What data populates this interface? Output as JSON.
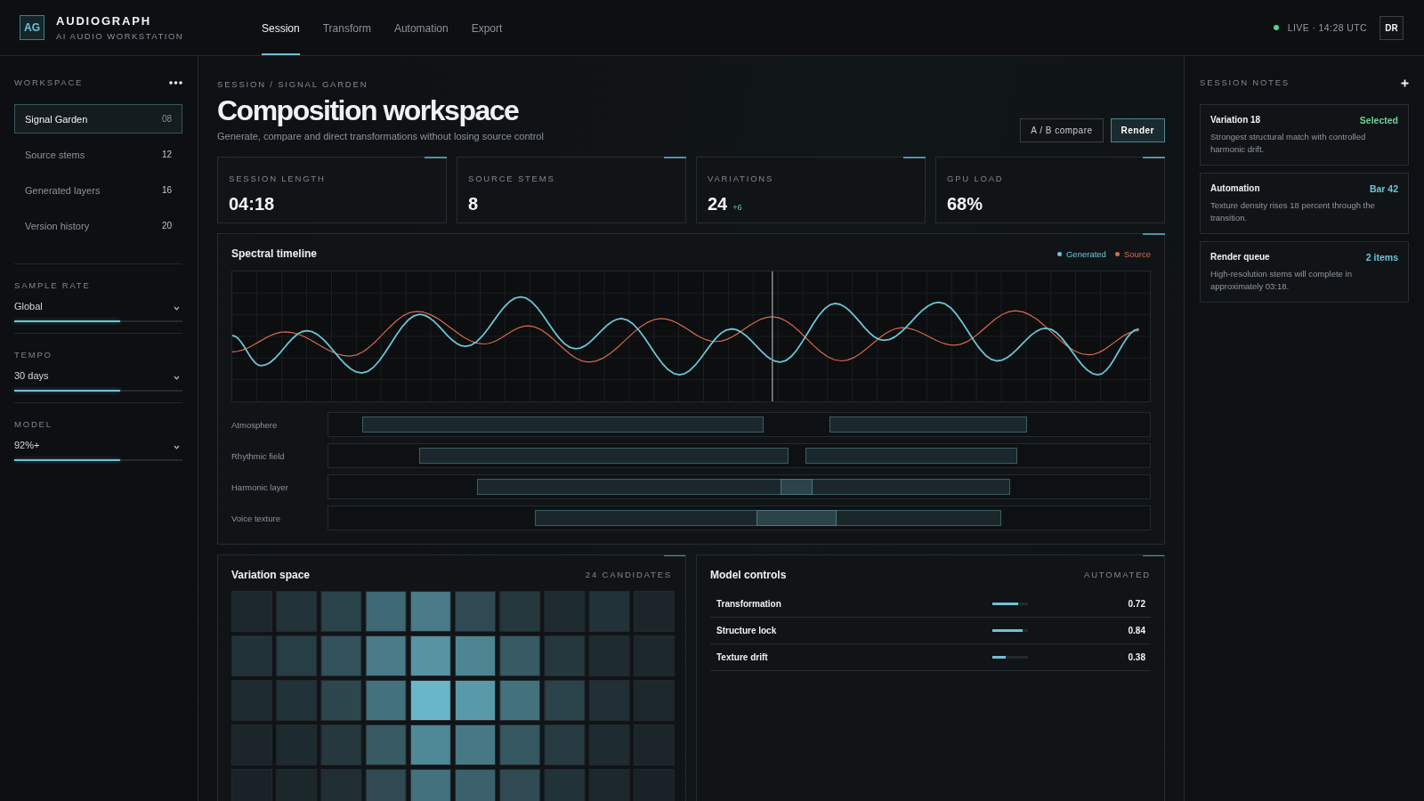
{
  "app": {
    "logo": "AG",
    "name": "AUDIOGRAPH",
    "tagline": "AI AUDIO WORKSTATION"
  },
  "nav": [
    {
      "label": "Session",
      "selected": true
    },
    {
      "label": "Transform",
      "selected": false
    },
    {
      "label": "Automation",
      "selected": false
    },
    {
      "label": "Export",
      "selected": false
    }
  ],
  "status": {
    "live": true,
    "text": "LIVE · 14:28 UTC"
  },
  "user": {
    "initials": "DR"
  },
  "sidebar": {
    "title": "WORKSPACE",
    "items": [
      {
        "label": "Signal Garden",
        "count": "08",
        "selected": true
      },
      {
        "label": "Source stems",
        "count": "12",
        "selected": false
      },
      {
        "label": "Generated layers",
        "count": "16",
        "selected": false
      },
      {
        "label": "Version history",
        "count": "20",
        "selected": false
      }
    ],
    "settings": [
      {
        "label": "SAMPLE RATE",
        "value": "Global",
        "level": 0.63
      },
      {
        "label": "TEMPO",
        "value": "30 days",
        "level": 0.63
      },
      {
        "label": "MODEL",
        "value": "92%+",
        "level": 0.63
      }
    ]
  },
  "page": {
    "breadcrumb": "SESSION / SIGNAL GARDEN",
    "title": "Composition workspace",
    "subtitle": "Generate, compare and direct transformations without losing source control",
    "buttons": [
      {
        "label": "A / B compare",
        "kind": "secondary"
      },
      {
        "label": "Render",
        "kind": "primary"
      }
    ]
  },
  "stats": [
    {
      "label": "SESSION LENGTH",
      "value": "04:18"
    },
    {
      "label": "SOURCE STEMS",
      "value": "8"
    },
    {
      "label": "VARIATIONS",
      "value": "24",
      "delta": "+6"
    },
    {
      "label": "GPU LOAD",
      "value": "68%"
    }
  ],
  "timeline": {
    "title": "Spectral timeline",
    "legend": [
      {
        "label": "Generated",
        "color": "#6cc3d5"
      },
      {
        "label": "Source",
        "color": "#d9694a"
      }
    ],
    "tracks": [
      {
        "name": "Atmosphere"
      },
      {
        "name": "Rhythmic field"
      },
      {
        "name": "Harmonic layer"
      },
      {
        "name": "Voice texture"
      }
    ]
  },
  "variation_space": {
    "title": "Variation space",
    "count": "24 CANDIDATES"
  },
  "model_controls": {
    "title": "Model controls",
    "status": "AUTOMATED",
    "params": [
      {
        "label": "Transformation",
        "level": 0.72,
        "reading": "0.72"
      },
      {
        "label": "Structure lock",
        "level": 0.84,
        "reading": "0.84"
      },
      {
        "label": "Texture drift",
        "level": 0.38,
        "reading": "0.38"
      }
    ]
  },
  "notes": {
    "title": "SESSION NOTES",
    "items": [
      {
        "title": "Variation 18",
        "tag": "Selected",
        "color": "#6fcf97",
        "body": "Strongest structural match with controlled harmonic drift."
      },
      {
        "title": "Automation",
        "tag": "Bar 42",
        "color": "#6cc3d5",
        "body": "Texture density rises 18 percent through the transition."
      },
      {
        "title": "Render queue",
        "tag": "2 items",
        "color": "#6cc3d5",
        "body": "High-resolution stems will complete in approximately 03:18."
      }
    ]
  }
}
